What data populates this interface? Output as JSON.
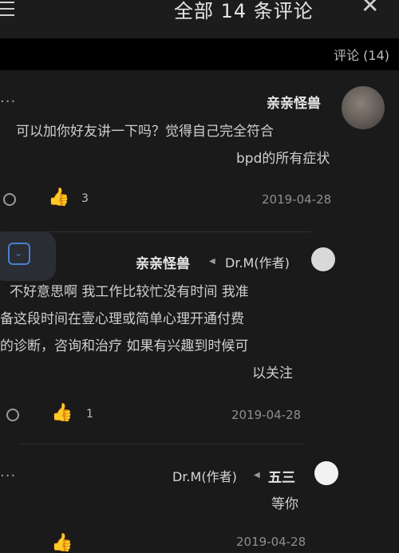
{
  "header": {
    "title": "全部 14 条评论",
    "close_glyph": "✕"
  },
  "section": {
    "label": "评论 (14)"
  },
  "comments": [
    {
      "user": "亲亲怪兽",
      "text_line1": "可以加你好友讲一下吗？觉得自己完全符合",
      "text_line2": "bpd的所有症状",
      "date": "2019-04-28",
      "like_count": "3",
      "more": "···"
    },
    {
      "user": "Dr.M(作者)",
      "reply_to": "亲亲怪兽",
      "text_line1": "不好意思啊 我工作比较忙没有时间 我准",
      "text_line2": "备这段时间在壹心理或简单心理开通付费",
      "text_line3": "的诊断，咨询和治疗 如果有兴趣到时候可",
      "text_line4": "以关注",
      "date": "2019-04-28",
      "like_count": "1"
    },
    {
      "user": "五三",
      "reply_to": "Dr.M(作者)",
      "text_line1": "等你",
      "date": "2019-04-28",
      "more": "···"
    }
  ]
}
